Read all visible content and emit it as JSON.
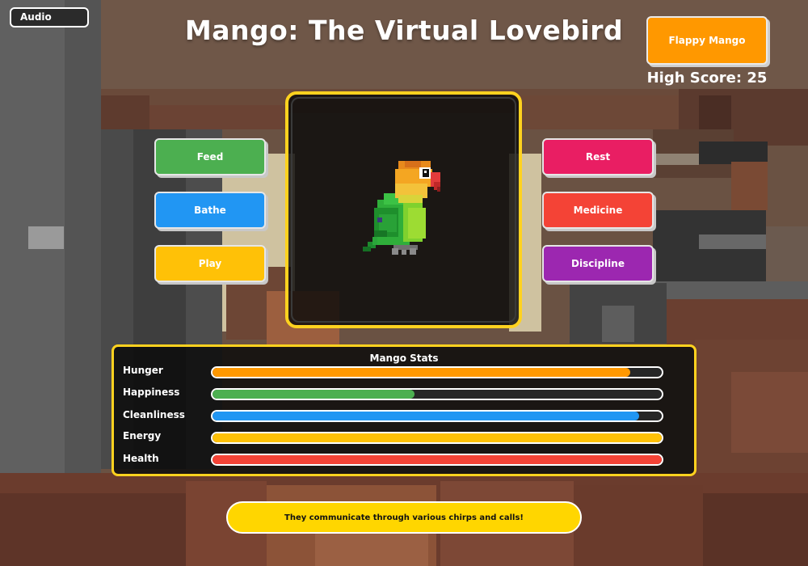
{
  "title": "Mango: The Virtual Lovebird",
  "audio_label": "Audio",
  "minigame": {
    "label": "Flappy Mango",
    "high_score_text": "High Score: 25"
  },
  "actions": {
    "feed": "Feed",
    "bathe": "Bathe",
    "play": "Play",
    "rest": "Rest",
    "medicine": "Medicine",
    "discipline": "Discipline"
  },
  "colors": {
    "feed": "#4caf50",
    "bathe": "#2196f3",
    "play": "#ffc107",
    "rest": "#e91e63",
    "medicine": "#f44336",
    "discipline": "#9c27b0",
    "frame_border": "#ffd21f",
    "minigame": "#ff9800",
    "fact_banner": "#ffd600"
  },
  "stats": {
    "title": "Mango Stats",
    "items": [
      {
        "label": "Hunger",
        "percent": 93,
        "color": "#ff9800"
      },
      {
        "label": "Happiness",
        "percent": 45,
        "color": "#4caf50"
      },
      {
        "label": "Cleanliness",
        "percent": 95,
        "color": "#2196f3"
      },
      {
        "label": "Energy",
        "percent": 100,
        "color": "#ffc107"
      },
      {
        "label": "Health",
        "percent": 100,
        "color": "#f44336"
      }
    ]
  },
  "fact": "They communicate through various chirps and calls!",
  "icons": {
    "pet": "lovebird-sprite"
  }
}
